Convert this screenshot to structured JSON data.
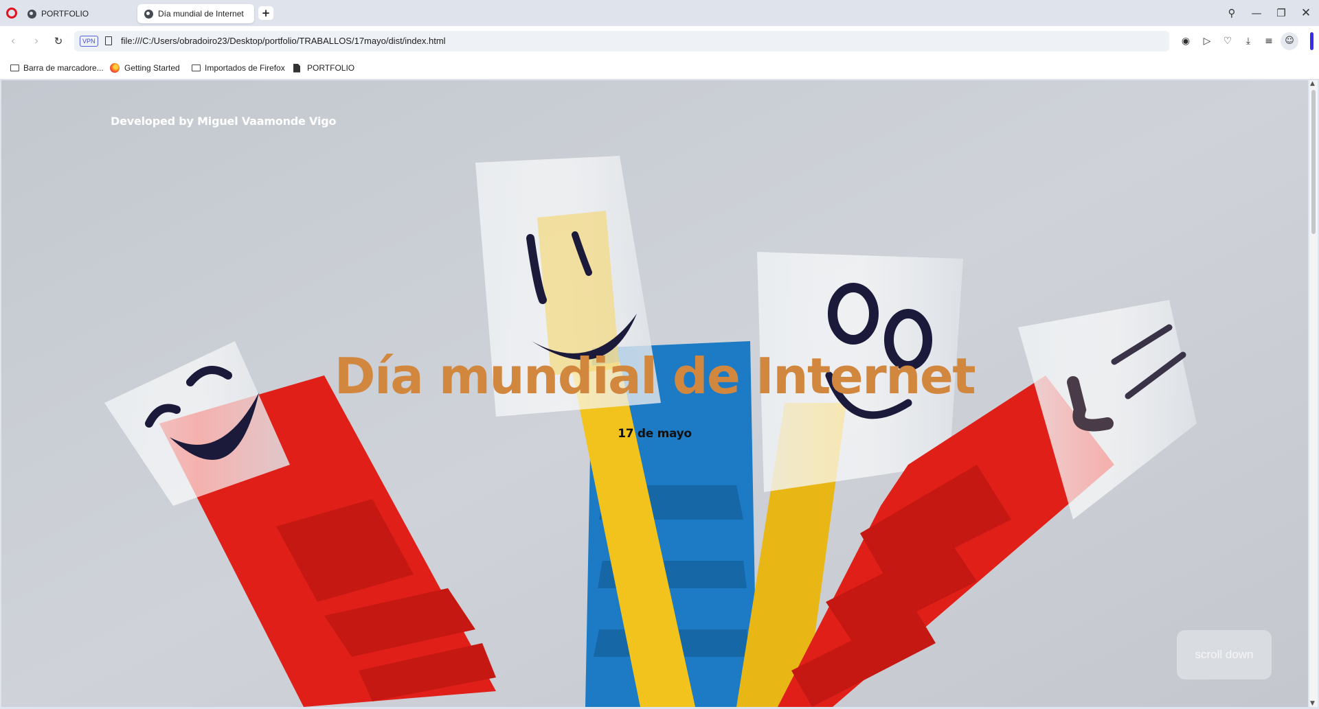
{
  "browser": {
    "tabs": [
      {
        "label": "PORTFOLIO"
      },
      {
        "label": "Día mundial de Internet"
      }
    ],
    "new_tab_label": "+",
    "url": "file:///C:/Users/obradoiro23/Desktop/portfolio/TRABALLOS/17mayo/dist/index.html",
    "vpn_label": "VPN",
    "bookmarks": [
      {
        "label": "Barra de marcadore..."
      },
      {
        "label": "Getting Started"
      },
      {
        "label": "Importados de Firefox"
      },
      {
        "label": "PORTFOLIO"
      }
    ]
  },
  "page": {
    "credit": "Developed by Miguel Vaamonde Vigo",
    "title": "Día mundial de Internet",
    "subtitle": "17 de mayo",
    "scroll_button": "scroll down"
  },
  "colors": {
    "title": "#d2873f",
    "opera_red": "#e0141e",
    "vpn_blue": "#3c46c8",
    "cable_red": "#e02018",
    "cable_yellow": "#f2c31c",
    "cable_blue": "#1d7ac4"
  },
  "icons": [
    "opera-logo",
    "globe-icon",
    "search-icon",
    "minimize-icon",
    "maximize-icon",
    "close-icon",
    "back-icon",
    "forward-icon",
    "reload-icon",
    "page-icon",
    "camera-icon",
    "play-icon",
    "heart-icon",
    "download-icon",
    "menu-icon",
    "profile-icon",
    "folder-icon",
    "firefox-icon",
    "document-icon"
  ]
}
